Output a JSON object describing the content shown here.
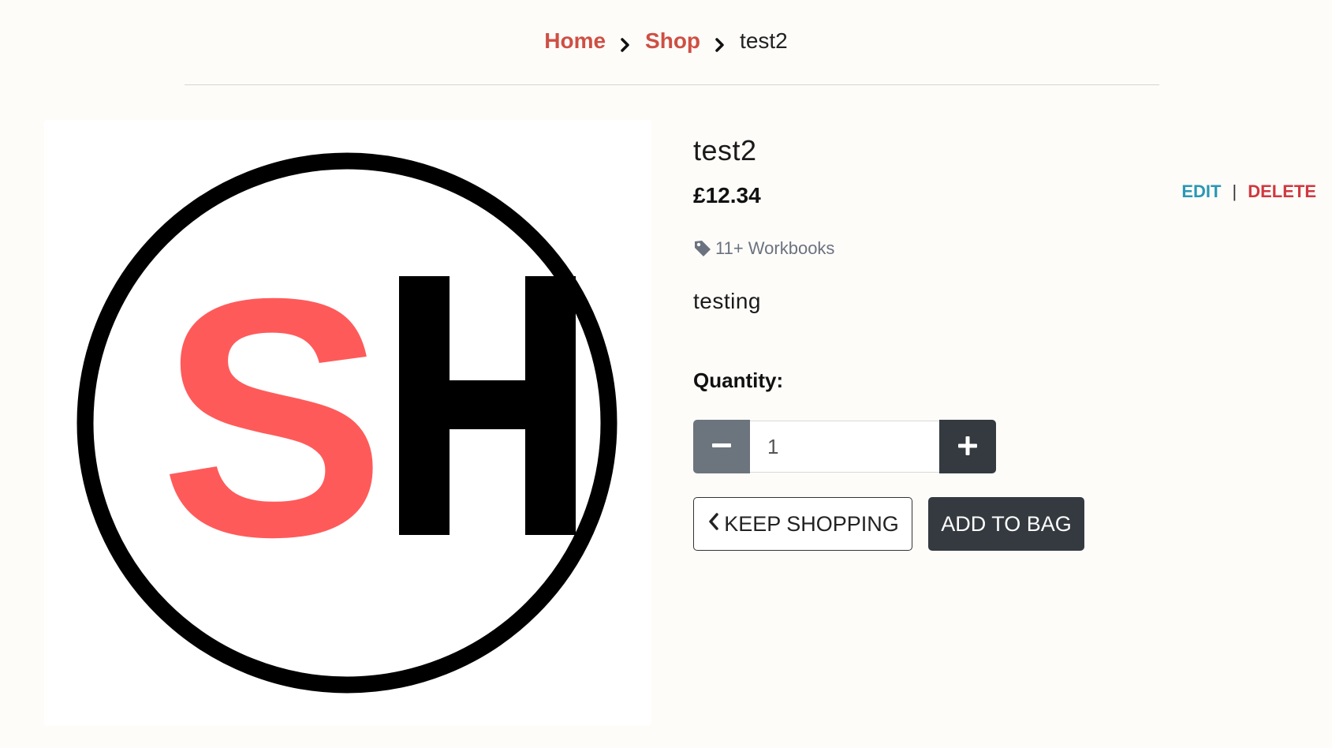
{
  "breadcrumb": {
    "home": "Home",
    "shop": "Shop",
    "current": "test2"
  },
  "product": {
    "name": "test2",
    "price": "£12.34",
    "category": "11+ Workbooks",
    "description": "testing",
    "logo_letters": "SH"
  },
  "admin": {
    "edit_label": "EDIT",
    "separator": "|",
    "delete_label": "DELETE"
  },
  "quantity": {
    "label": "Quantity:",
    "value": "1"
  },
  "buttons": {
    "keep_shopping": "KEEP SHOPPING",
    "add_to_bag": "ADD TO BAG"
  },
  "colors": {
    "link_red": "#cf4f43",
    "edit_blue": "#2a97b5",
    "delete_red": "#d0383f",
    "logo_red": "#ff5a5a",
    "dark_button": "#343a40",
    "gray_button": "#6c757d"
  },
  "icons": {
    "breadcrumb_separator": "chevron-right-icon",
    "category": "tag-icon",
    "decrement": "minus-icon",
    "increment": "plus-icon",
    "keep_shopping": "chevron-left-icon"
  }
}
